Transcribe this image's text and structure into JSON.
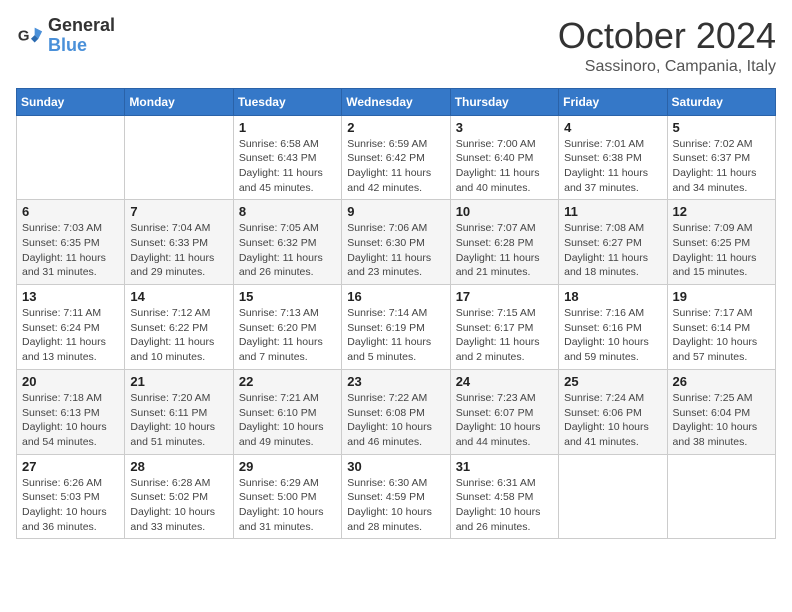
{
  "header": {
    "logo_line1": "General",
    "logo_line2": "Blue",
    "month": "October 2024",
    "location": "Sassinoro, Campania, Italy"
  },
  "weekdays": [
    "Sunday",
    "Monday",
    "Tuesday",
    "Wednesday",
    "Thursday",
    "Friday",
    "Saturday"
  ],
  "weeks": [
    [
      {
        "day": "",
        "info": ""
      },
      {
        "day": "",
        "info": ""
      },
      {
        "day": "1",
        "info": "Sunrise: 6:58 AM\nSunset: 6:43 PM\nDaylight: 11 hours and 45 minutes."
      },
      {
        "day": "2",
        "info": "Sunrise: 6:59 AM\nSunset: 6:42 PM\nDaylight: 11 hours and 42 minutes."
      },
      {
        "day": "3",
        "info": "Sunrise: 7:00 AM\nSunset: 6:40 PM\nDaylight: 11 hours and 40 minutes."
      },
      {
        "day": "4",
        "info": "Sunrise: 7:01 AM\nSunset: 6:38 PM\nDaylight: 11 hours and 37 minutes."
      },
      {
        "day": "5",
        "info": "Sunrise: 7:02 AM\nSunset: 6:37 PM\nDaylight: 11 hours and 34 minutes."
      }
    ],
    [
      {
        "day": "6",
        "info": "Sunrise: 7:03 AM\nSunset: 6:35 PM\nDaylight: 11 hours and 31 minutes."
      },
      {
        "day": "7",
        "info": "Sunrise: 7:04 AM\nSunset: 6:33 PM\nDaylight: 11 hours and 29 minutes."
      },
      {
        "day": "8",
        "info": "Sunrise: 7:05 AM\nSunset: 6:32 PM\nDaylight: 11 hours and 26 minutes."
      },
      {
        "day": "9",
        "info": "Sunrise: 7:06 AM\nSunset: 6:30 PM\nDaylight: 11 hours and 23 minutes."
      },
      {
        "day": "10",
        "info": "Sunrise: 7:07 AM\nSunset: 6:28 PM\nDaylight: 11 hours and 21 minutes."
      },
      {
        "day": "11",
        "info": "Sunrise: 7:08 AM\nSunset: 6:27 PM\nDaylight: 11 hours and 18 minutes."
      },
      {
        "day": "12",
        "info": "Sunrise: 7:09 AM\nSunset: 6:25 PM\nDaylight: 11 hours and 15 minutes."
      }
    ],
    [
      {
        "day": "13",
        "info": "Sunrise: 7:11 AM\nSunset: 6:24 PM\nDaylight: 11 hours and 13 minutes."
      },
      {
        "day": "14",
        "info": "Sunrise: 7:12 AM\nSunset: 6:22 PM\nDaylight: 11 hours and 10 minutes."
      },
      {
        "day": "15",
        "info": "Sunrise: 7:13 AM\nSunset: 6:20 PM\nDaylight: 11 hours and 7 minutes."
      },
      {
        "day": "16",
        "info": "Sunrise: 7:14 AM\nSunset: 6:19 PM\nDaylight: 11 hours and 5 minutes."
      },
      {
        "day": "17",
        "info": "Sunrise: 7:15 AM\nSunset: 6:17 PM\nDaylight: 11 hours and 2 minutes."
      },
      {
        "day": "18",
        "info": "Sunrise: 7:16 AM\nSunset: 6:16 PM\nDaylight: 10 hours and 59 minutes."
      },
      {
        "day": "19",
        "info": "Sunrise: 7:17 AM\nSunset: 6:14 PM\nDaylight: 10 hours and 57 minutes."
      }
    ],
    [
      {
        "day": "20",
        "info": "Sunrise: 7:18 AM\nSunset: 6:13 PM\nDaylight: 10 hours and 54 minutes."
      },
      {
        "day": "21",
        "info": "Sunrise: 7:20 AM\nSunset: 6:11 PM\nDaylight: 10 hours and 51 minutes."
      },
      {
        "day": "22",
        "info": "Sunrise: 7:21 AM\nSunset: 6:10 PM\nDaylight: 10 hours and 49 minutes."
      },
      {
        "day": "23",
        "info": "Sunrise: 7:22 AM\nSunset: 6:08 PM\nDaylight: 10 hours and 46 minutes."
      },
      {
        "day": "24",
        "info": "Sunrise: 7:23 AM\nSunset: 6:07 PM\nDaylight: 10 hours and 44 minutes."
      },
      {
        "day": "25",
        "info": "Sunrise: 7:24 AM\nSunset: 6:06 PM\nDaylight: 10 hours and 41 minutes."
      },
      {
        "day": "26",
        "info": "Sunrise: 7:25 AM\nSunset: 6:04 PM\nDaylight: 10 hours and 38 minutes."
      }
    ],
    [
      {
        "day": "27",
        "info": "Sunrise: 6:26 AM\nSunset: 5:03 PM\nDaylight: 10 hours and 36 minutes."
      },
      {
        "day": "28",
        "info": "Sunrise: 6:28 AM\nSunset: 5:02 PM\nDaylight: 10 hours and 33 minutes."
      },
      {
        "day": "29",
        "info": "Sunrise: 6:29 AM\nSunset: 5:00 PM\nDaylight: 10 hours and 31 minutes."
      },
      {
        "day": "30",
        "info": "Sunrise: 6:30 AM\nSunset: 4:59 PM\nDaylight: 10 hours and 28 minutes."
      },
      {
        "day": "31",
        "info": "Sunrise: 6:31 AM\nSunset: 4:58 PM\nDaylight: 10 hours and 26 minutes."
      },
      {
        "day": "",
        "info": ""
      },
      {
        "day": "",
        "info": ""
      }
    ]
  ]
}
